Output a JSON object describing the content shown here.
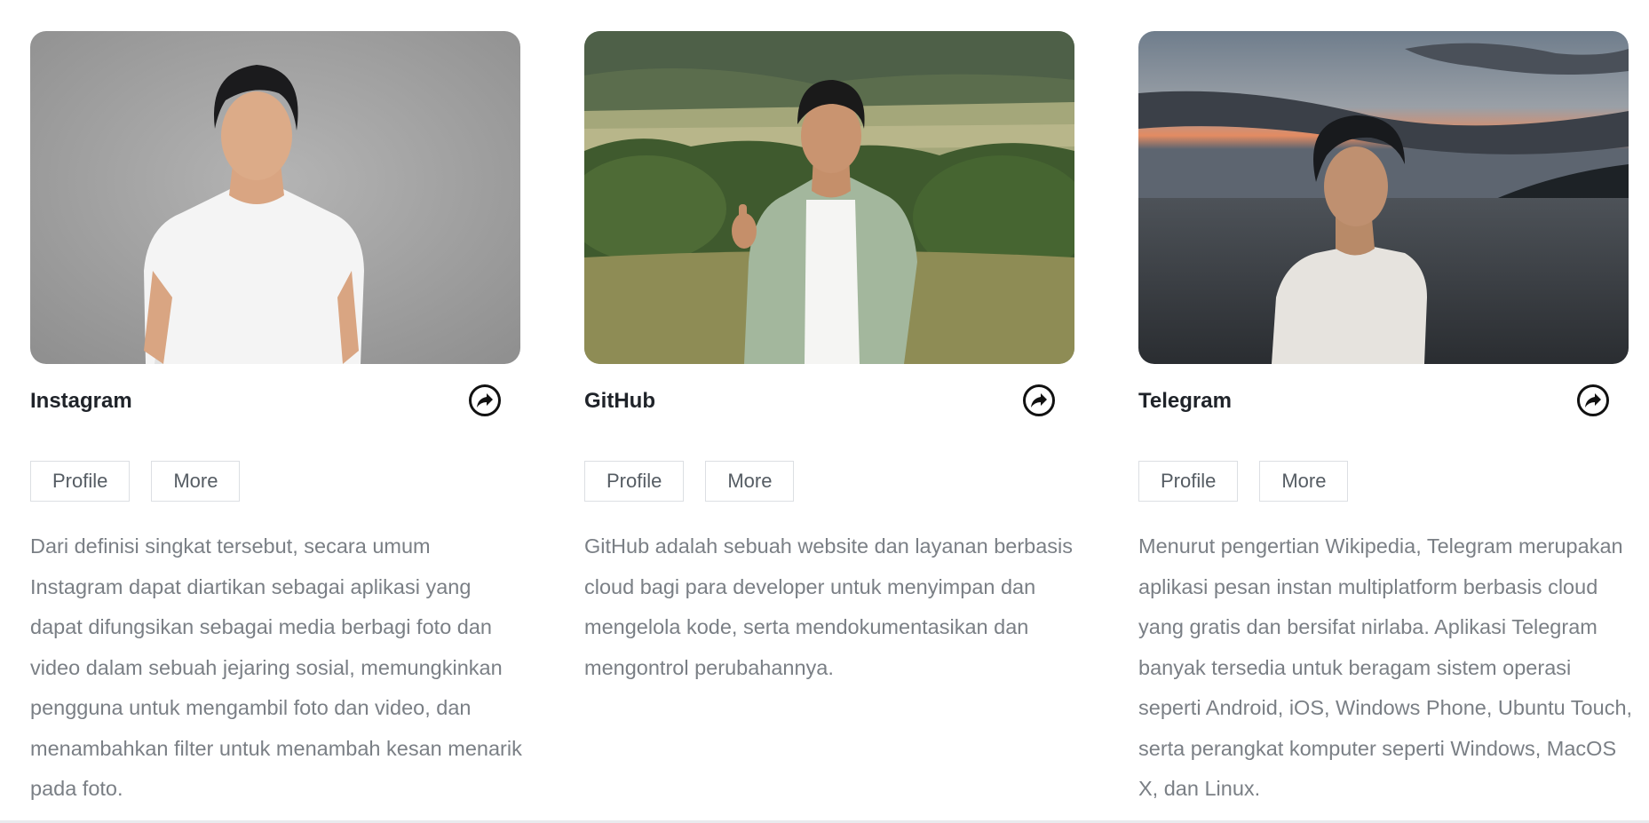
{
  "cards": [
    {
      "title": "Instagram",
      "profile_label": "Profile",
      "more_label": "More",
      "description": "Dari definisi singkat tersebut, secara umum Instagram dapat diartikan sebagai aplikasi yang dapat difungsikan sebagai media berbagi foto dan video dalam sebuah jejaring sosial, memungkinkan pengguna untuk mengambil foto dan video, dan menambahkan filter untuk menambah kesan menarik pada foto."
    },
    {
      "title": "GitHub",
      "profile_label": "Profile",
      "more_label": "More",
      "description": "GitHub adalah sebuah website dan layanan berbasis cloud bagi para developer untuk menyimpan dan mengelola kode, serta mendokumentasikan dan mengontrol perubahannya."
    },
    {
      "title": "Telegram",
      "profile_label": "Profile",
      "more_label": "More",
      "description": "Menurut pengertian Wikipedia, Telegram merupakan aplikasi pesan instan multiplatform berbasis cloud yang gratis dan bersifat nirlaba. Aplikasi Telegram banyak tersedia untuk beragam sistem operasi seperti Android, iOS, Windows Phone, Ubuntu Touch, serta perangkat komputer seperti Windows, MacOS X, dan Linux."
    }
  ],
  "icons": {
    "share": "share-arrow-icon"
  },
  "colors": {
    "title": "#1f2329",
    "text": "#7a7f85",
    "button_border": "#dcdfe3"
  }
}
